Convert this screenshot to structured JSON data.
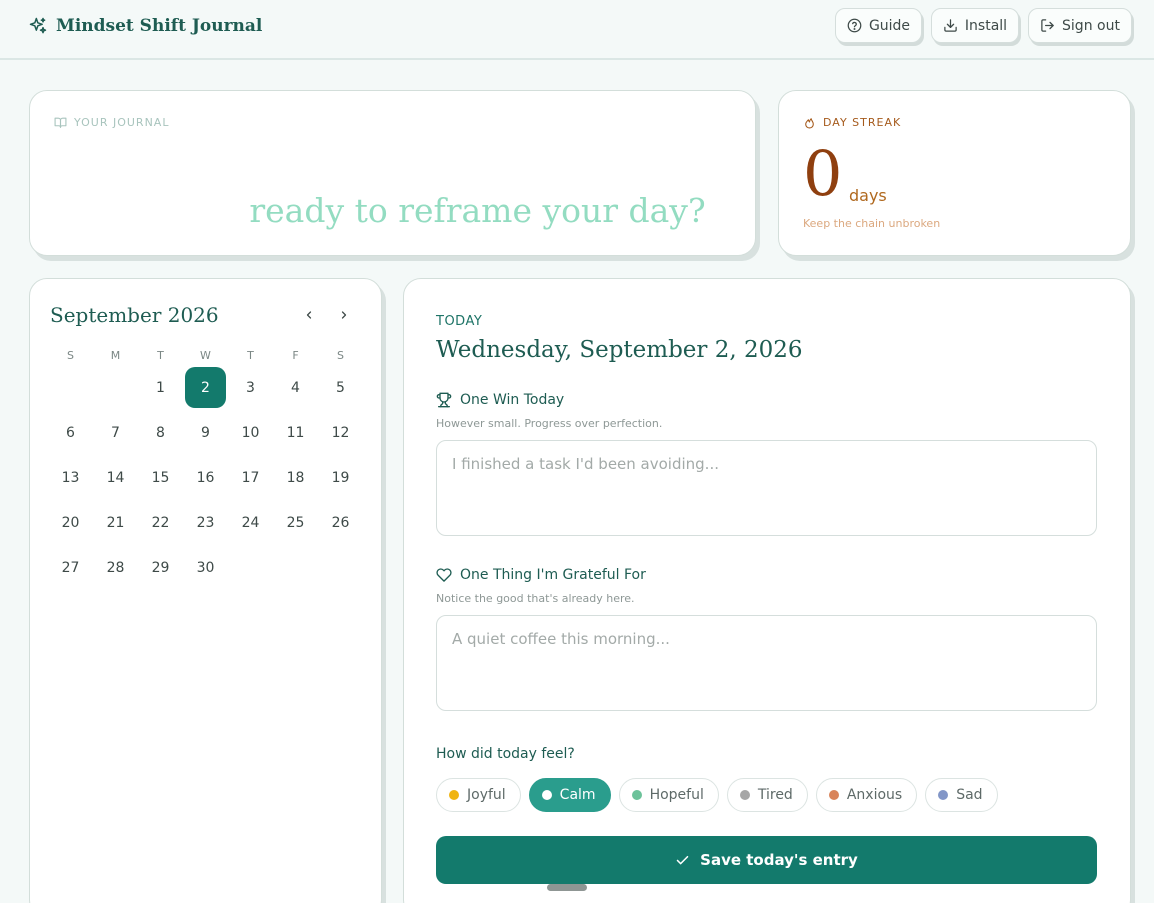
{
  "header": {
    "title": "Mindset Shift Journal",
    "buttons": {
      "guide": "Guide",
      "install": "Install",
      "signout": "Sign out"
    }
  },
  "journal": {
    "label": "Your Journal",
    "prompt": "ready to reframe your day?"
  },
  "streak": {
    "label": "Day Streak",
    "count": "0",
    "unit": "days",
    "subtitle": "Keep the chain unbroken"
  },
  "calendar": {
    "month_title": "September 2026",
    "weekdays": [
      "S",
      "M",
      "T",
      "W",
      "T",
      "F",
      "S"
    ],
    "leading_blanks": 2,
    "days": [
      "1",
      "2",
      "3",
      "4",
      "5",
      "6",
      "7",
      "8",
      "9",
      "10",
      "11",
      "12",
      "13",
      "14",
      "15",
      "16",
      "17",
      "18",
      "19",
      "20",
      "21",
      "22",
      "23",
      "24",
      "25",
      "26",
      "27",
      "28",
      "29",
      "30"
    ],
    "selected_day": "2"
  },
  "today": {
    "label": "TODAY",
    "date": "Wednesday, September 2, 2026",
    "win": {
      "label": "One Win Today",
      "hint": "However small. Progress over perfection.",
      "placeholder": "I finished a task I'd been avoiding..."
    },
    "grateful": {
      "label": "One Thing I'm Grateful For",
      "hint": "Notice the good that's already here.",
      "placeholder": "A quiet coffee this morning..."
    },
    "mood_question": "How did today feel?",
    "moods": [
      {
        "label": "Joyful",
        "color": "#f0b410"
      },
      {
        "label": "Calm",
        "color": "#ffffff"
      },
      {
        "label": "Hopeful",
        "color": "#6cc29a"
      },
      {
        "label": "Tired",
        "color": "#a6a6a6"
      },
      {
        "label": "Anxious",
        "color": "#d9845a"
      },
      {
        "label": "Sad",
        "color": "#8296c7"
      }
    ],
    "active_mood": "Calm",
    "save_label": "Save today's entry"
  }
}
